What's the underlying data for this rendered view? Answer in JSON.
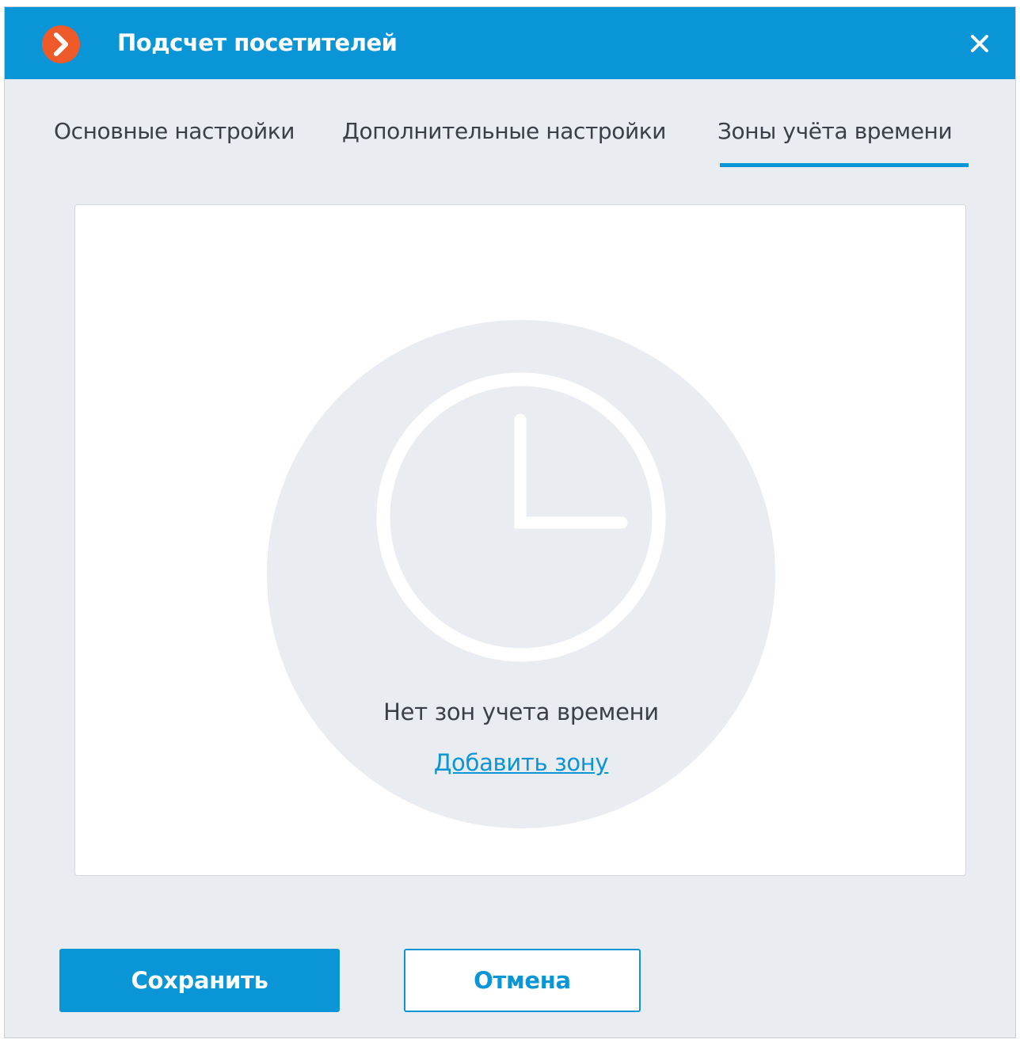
{
  "window": {
    "title": "Подсчет посетителей",
    "close_icon": "close-icon",
    "logo_icon": "app-logo-icon",
    "accent_color": "#0a96d6"
  },
  "tabs": [
    {
      "label": "Основные настройки",
      "active": false
    },
    {
      "label": "Дополнительные настройки",
      "active": false
    },
    {
      "label": "Зоны учёта времени",
      "active": true
    }
  ],
  "empty_state": {
    "icon": "clock-icon",
    "message": "Нет зон учета времени",
    "action_link": "Добавить зону"
  },
  "footer": {
    "save_label": "Сохранить",
    "cancel_label": "Отмена"
  }
}
